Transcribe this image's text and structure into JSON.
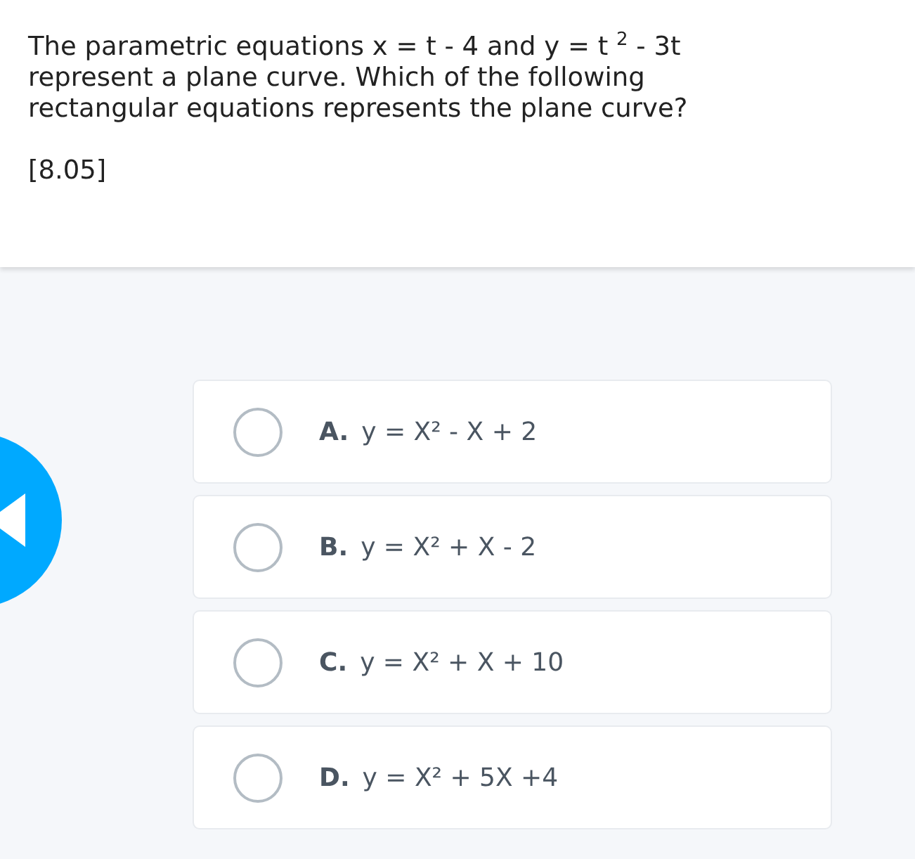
{
  "question": {
    "text": "The parametric equations x = t - 4 and y = t $^{2}$ - 3t represent a plane curve. Which of the following rectangular equations represents the plane curve?",
    "reference": "[8.05]"
  },
  "options": [
    {
      "letter": "A.",
      "text": "y = X² - X + 2",
      "selected": false
    },
    {
      "letter": "B.",
      "text": "y = X² + X - 2",
      "selected": false
    },
    {
      "letter": "C.",
      "text": "y = X² + X + 10",
      "selected": false
    },
    {
      "letter": "D.",
      "text": "y = X² + 5X +4",
      "selected": false
    }
  ]
}
